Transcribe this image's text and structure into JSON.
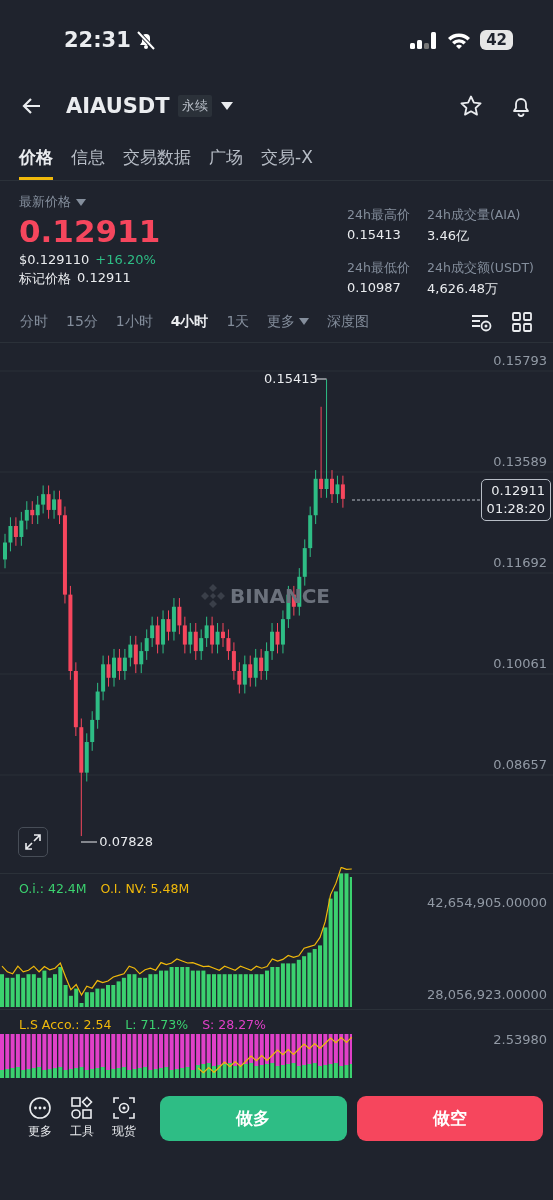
{
  "status_bar": {
    "time": "22:31",
    "battery": "42"
  },
  "header": {
    "symbol": "AIAUSDT",
    "contract_tag": "永续"
  },
  "tabs": [
    {
      "label": "价格",
      "selected": true
    },
    {
      "label": "信息",
      "selected": false
    },
    {
      "label": "交易数据",
      "selected": false
    },
    {
      "label": "广场",
      "selected": false
    },
    {
      "label": "交易-X",
      "selected": false
    }
  ],
  "price": {
    "label": "最新价格",
    "last": "0.12911",
    "usd": "$0.129110",
    "change": "+16.20%",
    "mark_label": "标记价格",
    "mark": "0.12911"
  },
  "stats": [
    {
      "label": "24h最高价",
      "value": "0.15413"
    },
    {
      "label": "24h成交量(AIA)",
      "value": "3.46亿"
    },
    {
      "label": "24h最低价",
      "value": "0.10987"
    },
    {
      "label": "24h成交额(USDT)",
      "value": "4,626.48万"
    }
  ],
  "intervals": [
    {
      "label": "分时",
      "selected": false
    },
    {
      "label": "15分",
      "selected": false
    },
    {
      "label": "1小时",
      "selected": false
    },
    {
      "label": "4小时",
      "selected": true
    },
    {
      "label": "1天",
      "selected": false
    },
    {
      "label": "更多",
      "selected": false,
      "kind": "dropdown"
    },
    {
      "label": "深度图",
      "selected": false
    }
  ],
  "chart": {
    "watermark": "BINANCE",
    "y_labels": [
      "0.15793",
      "0.13589",
      "0.11692",
      "0.10061",
      "0.08657"
    ],
    "high_marker": "0.15413",
    "low_marker": "0.07828",
    "price_tag": "0.12911",
    "countdown": "01:28:20"
  },
  "open_interest": {
    "oi": "O.i.: 42.4M",
    "oi_nv": "O.I. NV: 5.48M",
    "y_labels": [
      "42,654,905.00000",
      "28,056,923.00000"
    ]
  },
  "long_short": {
    "ratio": "L.S Acco.: 2.54",
    "long": "L: 71.73%",
    "short": "S: 28.27%",
    "y_label": "2.53980"
  },
  "bottom_bar": {
    "tools": [
      {
        "kind": "more",
        "label": "更多"
      },
      {
        "kind": "tools",
        "label": "工具"
      },
      {
        "kind": "spot",
        "label": "现货"
      }
    ],
    "buy": "做多",
    "sell": "做空"
  }
}
